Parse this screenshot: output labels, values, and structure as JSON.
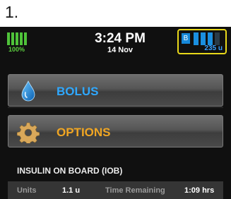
{
  "step": {
    "number": "1."
  },
  "status": {
    "battery_label": "100%",
    "battery_level_fraction": 1.0,
    "time": "3:24 PM",
    "date": "14 Nov",
    "insulin_badge": "B",
    "insulin_label": "235 u",
    "insulin_level_fraction": 0.75
  },
  "menu": {
    "bolus_label": "BOLUS",
    "options_label": "OPTIONS",
    "bolus_icon": "water-drop-icon",
    "options_icon": "gear-icon"
  },
  "iob": {
    "title": "INSULIN ON BOARD (IOB)",
    "units_label": "Units",
    "units_value": "1.1 u",
    "time_label": "Time Remaining",
    "time_value": "1:09 hrs"
  },
  "colors": {
    "screen_bg": "#101010",
    "battery_green": "#4fc33a",
    "insulin_blue": "#1a8fe0",
    "highlight_yellow": "#e8d81a",
    "bolus_blue": "#2fa8ff",
    "options_orange": "#f0a623"
  }
}
